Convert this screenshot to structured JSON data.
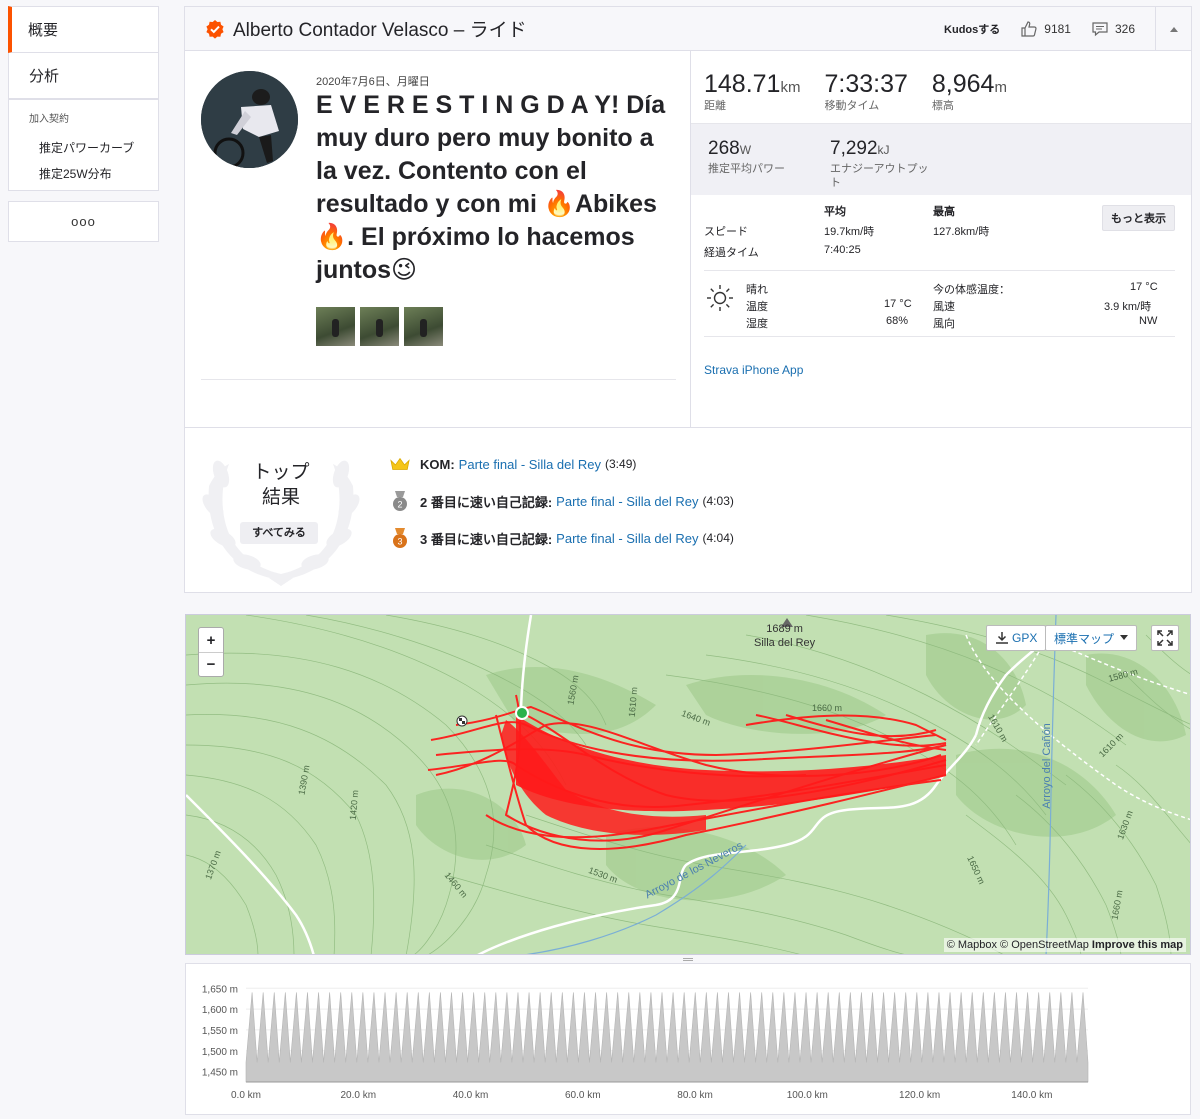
{
  "sidebar": {
    "tabs": [
      {
        "label": "概要"
      },
      {
        "label": "分析"
      }
    ],
    "subscription_title": "加入契約",
    "sub_items": [
      {
        "label": "推定パワーカーブ"
      },
      {
        "label": "推定25W分布"
      }
    ],
    "more_label": "ooo"
  },
  "header": {
    "title": "Alberto Contador Velasco – ライド",
    "kudos_label": "Kudosする",
    "kudos_count": "9181",
    "comments_count": "326"
  },
  "activity": {
    "date": "2020年7月6日、月曜日",
    "description": "E V E R E S T I N G D A Y! Día muy duro pero muy bonito a la vez. Contento con el resultado y con mi 🔥Abikes🔥. El próximo lo hacemos juntos😉",
    "photo_count": 3
  },
  "stats": {
    "distance": {
      "value": "148.71",
      "unit": "km",
      "label": "距離"
    },
    "moving_time": {
      "value": "7:33:37",
      "unit": "",
      "label": "移動タイム"
    },
    "elevation": {
      "value": "8,964",
      "unit": "m",
      "label": "標高"
    },
    "power": {
      "value": "268",
      "unit": "W",
      "label": "推定平均パワー"
    },
    "energy": {
      "value": "7,292",
      "unit": "kJ",
      "label": "エナジーアウトプット"
    }
  },
  "speed_table": {
    "col_avg": "平均",
    "col_max": "最高",
    "more_label": "もっと表示",
    "speed_label": "スピード",
    "speed_avg": "19.7km/時",
    "speed_max": "127.8km/時",
    "elapsed_label": "経過タイム",
    "elapsed_avg": "7:40:25"
  },
  "weather": {
    "condition": "晴れ",
    "temp_label": "温度",
    "temp_value": "17 °C",
    "humidity_label": "湿度",
    "humidity_value": "68%",
    "feels_label": "今の体感温度：",
    "feels_value": "17 °C",
    "wind_label": "風速",
    "wind_value": "3.9 km/時",
    "wind_dir_label": "風向",
    "wind_dir_value": "NW"
  },
  "device": "Strava iPhone App",
  "top_results": {
    "title_line1": "トップ",
    "title_line2": "結果",
    "button": "すべてみる",
    "items": [
      {
        "label": "KOM:",
        "segment": "Parte final - Silla del Rey",
        "time": "(3:49)",
        "badge": ""
      },
      {
        "label": "2 番目に速い自己記録:",
        "segment": "Parte final - Silla del Rey",
        "time": "(4:03)",
        "badge": "2"
      },
      {
        "label": "3 番目に速い自己記録:",
        "segment": "Parte final - Silla del Rey",
        "time": "(4:04)",
        "badge": "3"
      }
    ]
  },
  "map": {
    "zoom_in": "+",
    "zoom_out": "−",
    "gpx_label": "GPX",
    "map_type_label": "標準マップ",
    "peak_elev": "1689 m",
    "peak_name": "Silla del Rey",
    "stream1": "Arroyo de los Neveros",
    "stream2": "Arroyo del Cañón",
    "attribution_prefix": "© Mapbox © OpenStreetMap",
    "attribution_link": "Improve this map",
    "contours": [
      "1560 m",
      "1610 m",
      "1640 m",
      "1660 m",
      "1580 m",
      "1610 m",
      "1610 m",
      "1390 m",
      "1420 m",
      "1370 m",
      "1460 m",
      "1530 m",
      "1630 m",
      "1650 m",
      "1660 m"
    ],
    "colors": {
      "route": "#ff1a1a",
      "terrain": "#bcdcab",
      "start": "#2bb24c"
    }
  },
  "chart_data": {
    "type": "area",
    "y_ticks": [
      "1,650 m",
      "1,600 m",
      "1,550 m",
      "1,500 m",
      "1,450 m"
    ],
    "x_ticks": [
      "0.0 km",
      "20.0 km",
      "40.0 km",
      "60.0 km",
      "80.0 km",
      "100.0 km",
      "120.0 km",
      "140.0 km"
    ],
    "xlim": [
      0,
      150
    ],
    "ylim": [
      1425,
      1665
    ],
    "repeats": 76,
    "low": 1472,
    "high": 1640,
    "color": "#c8c8c8"
  }
}
